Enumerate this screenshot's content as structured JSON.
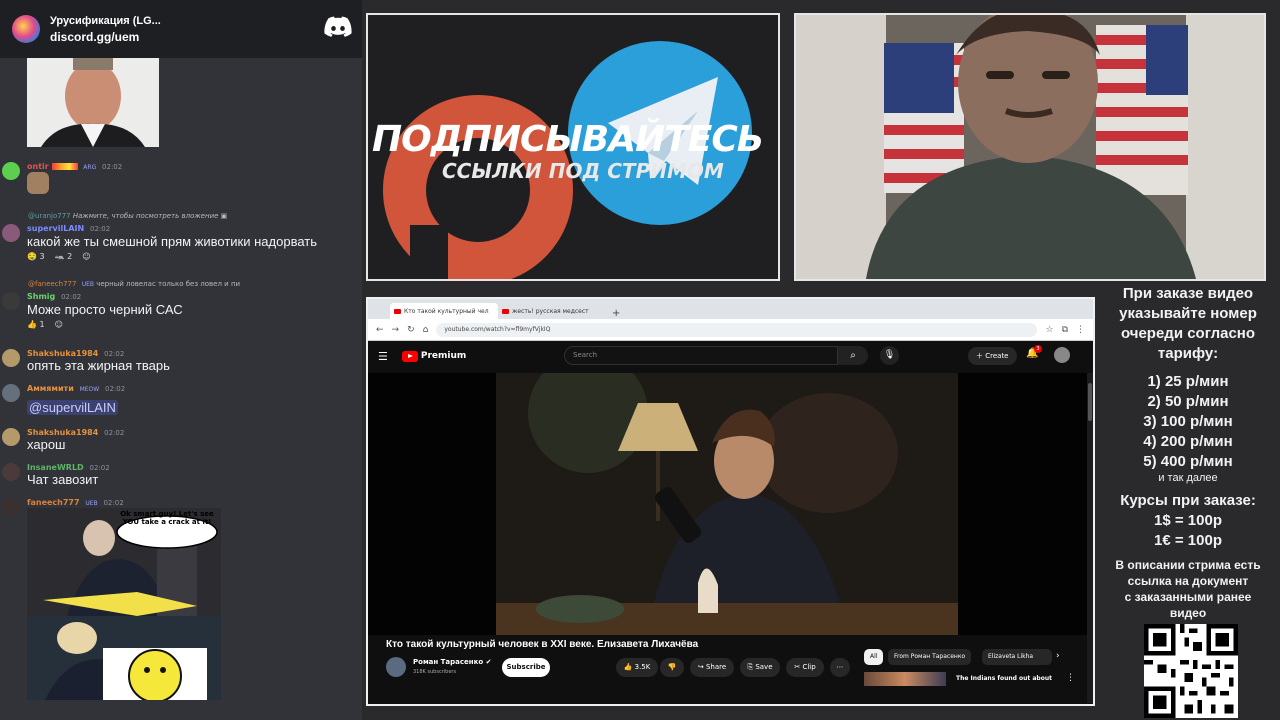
{
  "discord": {
    "server_title": "Урусификация (LG...",
    "invite": "discord.gg/uem"
  },
  "chat": {
    "messages": [
      {
        "user": "ontir",
        "time": "02:02",
        "tag": "ARG"
      },
      {
        "reply_user": "@uranjo777",
        "reply_text": "Нажмите, чтобы посмотреть вложение",
        "user": "supervilLAIN",
        "time": "02:02",
        "text": "какой же ты смешной прям животики надорвать",
        "reactions": [
          "3",
          "2"
        ]
      },
      {
        "reply_user": "@faneech777",
        "reply_tag": "UEB",
        "reply_text": "черный ловелас только без ловел и пи",
        "user": "Shmig",
        "time": "02:02",
        "text": "Може просто черний САС",
        "reactions": [
          "1"
        ]
      },
      {
        "user": "Shakshuka1984",
        "time": "02:02",
        "text": "опять эта жирная тварь"
      },
      {
        "user": "Аммямити",
        "tag": "MEOW",
        "time": "02:02",
        "mention": "@supervilLAIN"
      },
      {
        "user": "Shakshuka1984",
        "time": "02:02",
        "text": "харош"
      },
      {
        "user": "InsaneWRLD",
        "time": "02:02",
        "text": "Чат завозит"
      },
      {
        "user": "faneech777",
        "tag": "UEB",
        "time": "02:02",
        "meme_text": "Ok smart guy! Let's see YOU take a crack at it!"
      }
    ]
  },
  "overlay": {
    "subscribe_main": "ПОДПИСЫВАЙТЕСЬ",
    "subscribe_sub": "ССЫЛКИ ПОД СТРИМОМ"
  },
  "browser": {
    "tabs": [
      "Кто такой культурный чел",
      "жесть! русская медсест"
    ],
    "url": "youtube.com/watch?v=fl9myfVjkIQ",
    "yt_brand": "Premium",
    "search_placeholder": "Search",
    "create_label": "Create",
    "notif_count": "3",
    "video_title": "Кто такой культурный человек в XXI веке. Елизавета Лихачёва",
    "channel_name": "Роман Тарасенко",
    "channel_subs": "318K subscribers",
    "subscribe_label": "Subscribe",
    "like_count": "3.5K",
    "share_label": "Share",
    "save_label": "Save",
    "clip_label": "Clip",
    "chips": [
      "All",
      "From Роман Тарасенко",
      "Elizaveta Likha"
    ],
    "rec_title": "The Indians found out about"
  },
  "info": {
    "intro": [
      "При заказе видео",
      "указывайте номер",
      "очереди согласно",
      "тарифу:"
    ],
    "tariffs": [
      "1) 25 р/мин",
      "2) 50 р/мин",
      "3) 100 р/мин",
      "4) 200 р/мин",
      "5) 400 р/мин"
    ],
    "etc": "и так далее",
    "rates_title": "Курсы при заказе:",
    "rates": [
      "1$ = 100р",
      "1€ = 100р"
    ],
    "desc": [
      "В описании стрима есть",
      "ссылка на документ",
      "с заказанными ранее",
      "видео"
    ]
  },
  "colors": {
    "discord_bg": "#313338",
    "yt_red": "#ff0000",
    "telegram_blue": "#2a9fd9",
    "patreon_orange": "#e8573c"
  }
}
